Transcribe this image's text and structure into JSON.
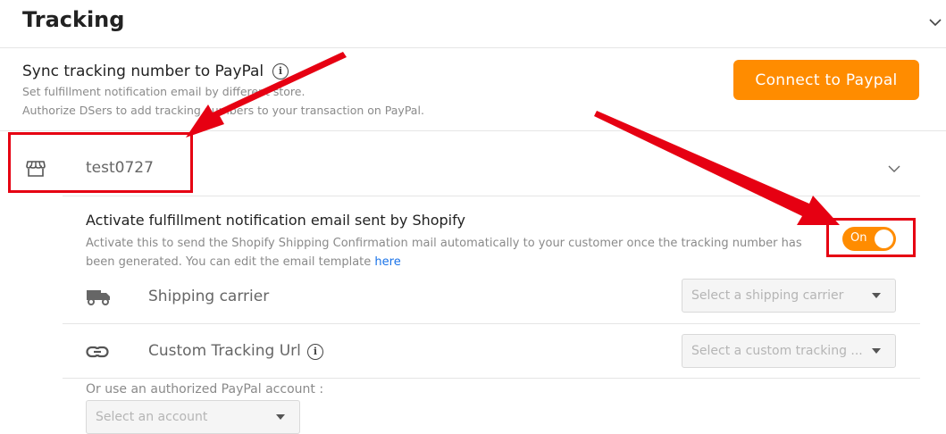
{
  "header": {
    "title": "Tracking"
  },
  "sync": {
    "title": "Sync tracking number to PayPal",
    "desc_line1": "Set fulfillment notification email by different store.",
    "desc_line2": "Authorize DSers to add tracking numbers to your transaction on PayPal.",
    "connect_label": "Connect to Paypal",
    "accent": "#ff8c00"
  },
  "store": {
    "name": "test0727",
    "icon": "store-icon"
  },
  "activate": {
    "title": "Activate fulfillment notification email sent by Shopify",
    "desc": "Activate this to send the Shopify Shipping Confirmation mail automatically to your customer once the tracking number has been generated. You can edit the email template ",
    "link": "here",
    "toggle_label": "On",
    "toggle_on": true
  },
  "shipping": {
    "label": "Shipping carrier",
    "placeholder": "Select a shipping carrier",
    "icon": "truck-icon"
  },
  "custom_url": {
    "label": "Custom Tracking Url",
    "placeholder": "Select a custom tracking ...",
    "icon": "link-icon"
  },
  "paypal_account": {
    "label": "Or use an authorized PayPal account :",
    "placeholder": "Select an account"
  },
  "annotation_color": "#e60012"
}
